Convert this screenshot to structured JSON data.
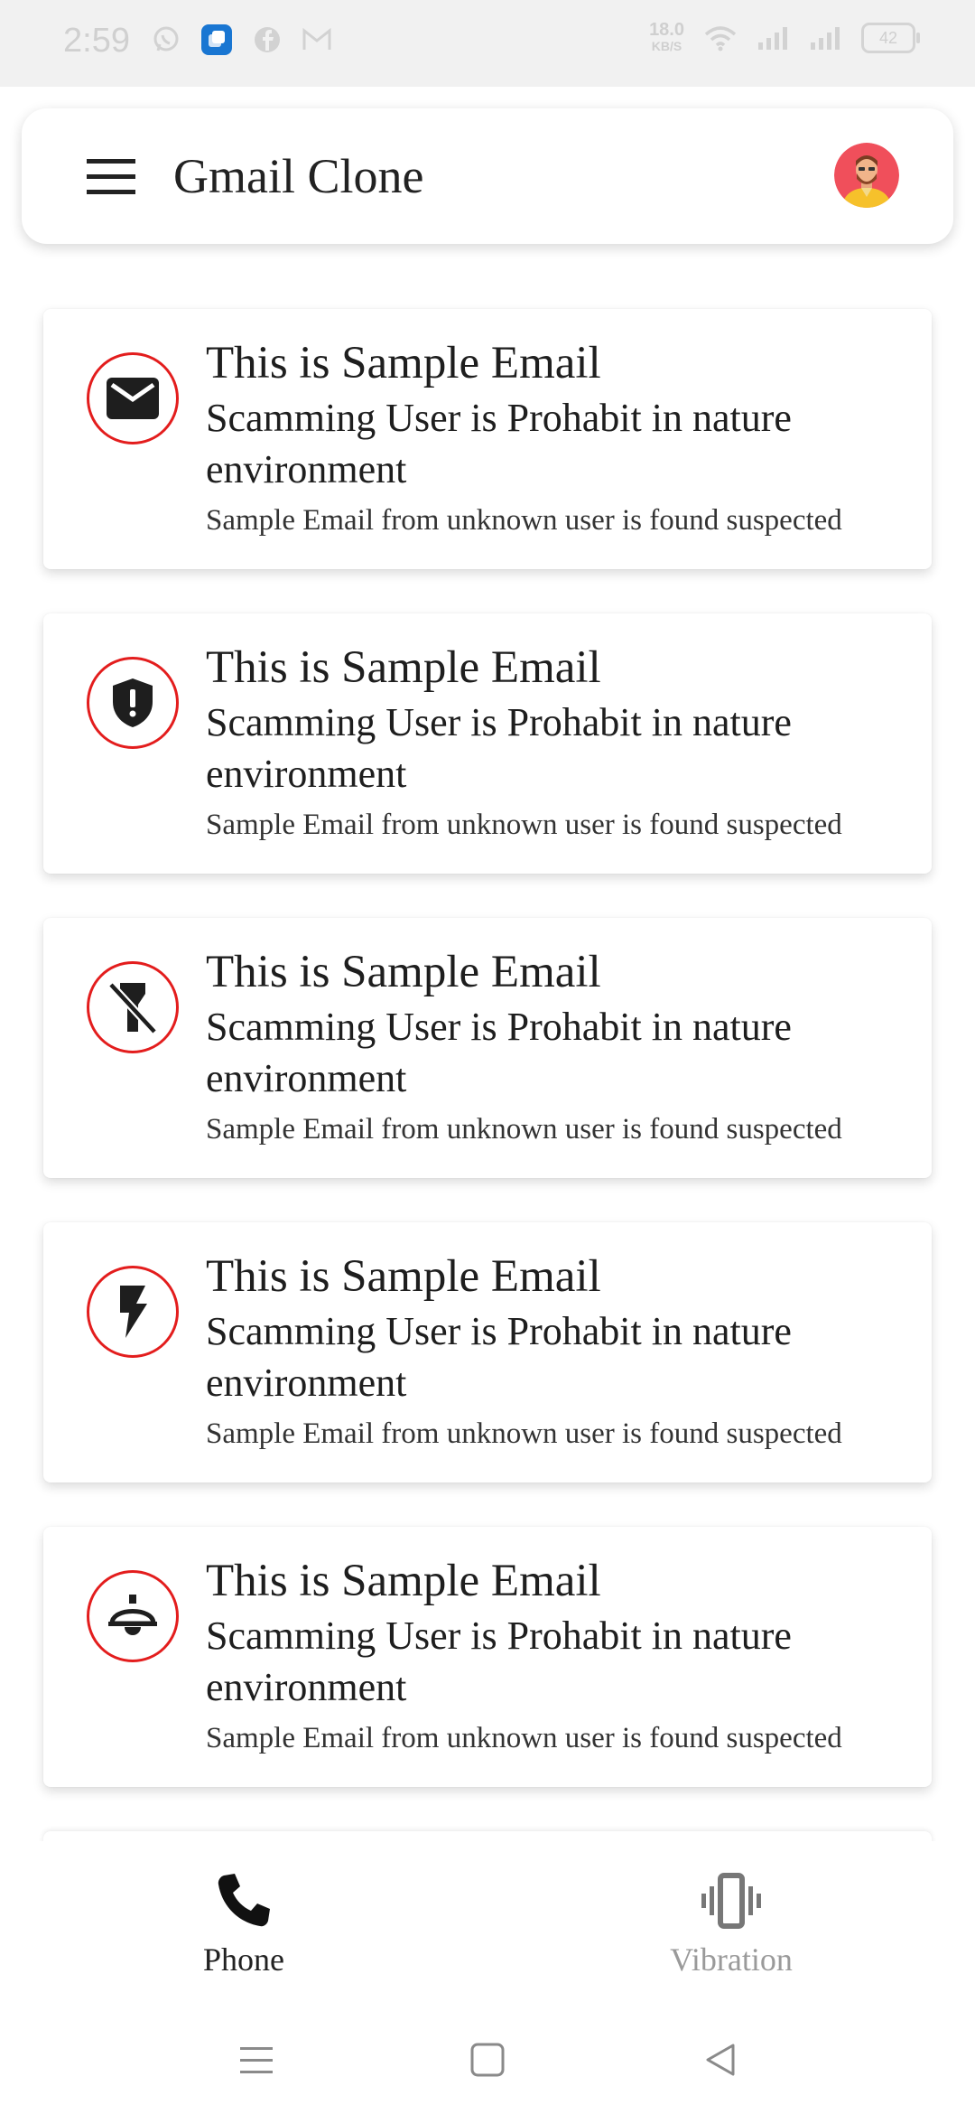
{
  "status_bar": {
    "time": "2:59",
    "network_speed_value": "18.0",
    "network_speed_unit": "KB/S",
    "battery": "42",
    "icons": [
      "whatsapp-icon",
      "app-icon",
      "facebook-icon",
      "gmail-icon",
      "wifi-icon",
      "signal-icon",
      "signal-icon"
    ]
  },
  "app_bar": {
    "title": "Gmail Clone",
    "menu_icon": "hamburger-menu-icon",
    "avatar_icon": "user-avatar"
  },
  "accent_color": "#e31d1d",
  "emails": [
    {
      "icon": "email-icon",
      "title": "This is Sample Email",
      "subtitle": "Scamming User is Prohabit in nature environment",
      "preview": "Sample Email from unknown user is found suspected"
    },
    {
      "icon": "shield-alert-icon",
      "title": "This is Sample Email",
      "subtitle": "Scamming User is Prohabit in nature environment",
      "preview": "Sample Email from unknown user is found suspected"
    },
    {
      "icon": "flashlight-off-icon",
      "title": "This is Sample Email",
      "subtitle": "Scamming User is Prohabit in nature environment",
      "preview": "Sample Email from unknown user is found suspected"
    },
    {
      "icon": "flash-icon",
      "title": "This is Sample Email",
      "subtitle": "Scamming User is Prohabit in nature environment",
      "preview": "Sample Email from unknown user is found suspected"
    },
    {
      "icon": "bell-icon",
      "title": "This is Sample Email",
      "subtitle": "Scamming User is Prohabit in nature environment",
      "preview": "Sample Email from unknown user is found suspected"
    }
  ],
  "bottom_nav": {
    "items": [
      {
        "label": "Phone",
        "icon": "phone-icon",
        "active": true
      },
      {
        "label": "Vibration",
        "icon": "vibration-icon",
        "active": false
      }
    ]
  },
  "system_nav": {
    "buttons": [
      "recents-icon",
      "home-icon",
      "back-icon"
    ]
  }
}
